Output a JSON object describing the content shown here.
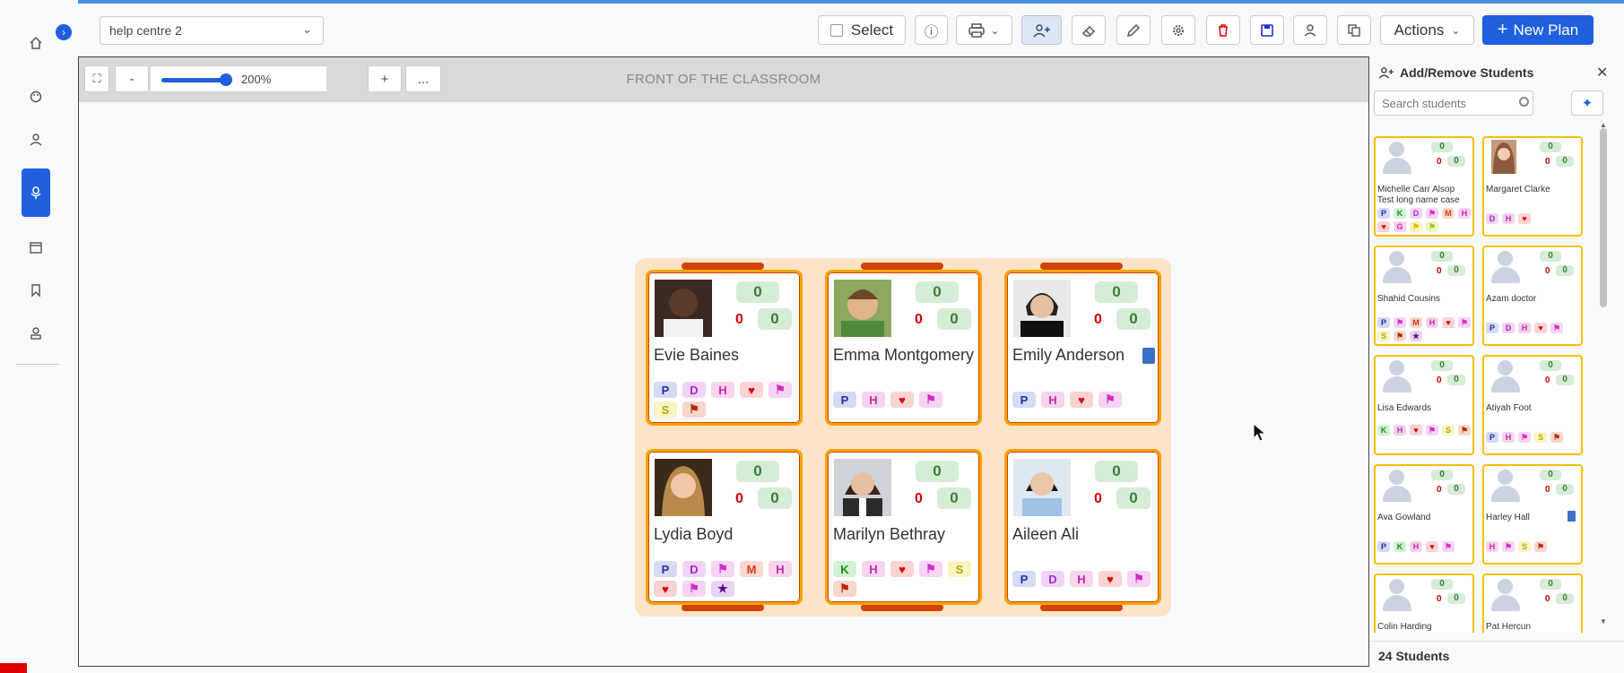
{
  "colors": {
    "accent": "#1f5fe0",
    "desk_border": "#f5a300",
    "desk_bar": "#d14300",
    "group_bg": "#fde3c7"
  },
  "nav": {
    "toggle_icon": "chevron-right-icon",
    "items": [
      {
        "icon": "home-icon"
      },
      {
        "icon": "palette-icon"
      },
      {
        "icon": "user-icon"
      },
      {
        "icon": "classroom-icon",
        "active": true
      },
      {
        "icon": "calendar-icon"
      },
      {
        "icon": "bookmark-icon"
      },
      {
        "icon": "teacher-icon"
      }
    ]
  },
  "toolbar": {
    "plan_name": "help centre 2",
    "select_label": "Select",
    "actions_label": "Actions",
    "new_plan_label": "New Plan"
  },
  "canvas": {
    "front_label": "FRONT OF THE CLASSROOM",
    "zoom_out": "-",
    "zoom_in": "+",
    "more": "...",
    "zoom_value": "200%"
  },
  "students_on_desk": [
    {
      "name": "Evie Baines",
      "score": "0",
      "neg": "0",
      "pos": "0",
      "tags": [
        "P",
        "D",
        "H",
        "heart",
        "flag",
        "S",
        "flag2"
      ]
    },
    {
      "name": "Emma Montgomery",
      "score": "0",
      "neg": "0",
      "pos": "0",
      "tags": [
        "P",
        "H",
        "heart",
        "flag"
      ]
    },
    {
      "name": "Emily Anderson",
      "score": "0",
      "neg": "0",
      "pos": "0",
      "tags": [
        "P",
        "H",
        "heart",
        "flag"
      ],
      "doc": true
    },
    {
      "name": "Lydia Boyd",
      "score": "0",
      "neg": "0",
      "pos": "0",
      "tags": [
        "P",
        "D",
        "flag",
        "M",
        "H",
        "heart",
        "flag",
        "star"
      ]
    },
    {
      "name": "Marilyn Bethray",
      "score": "0",
      "neg": "0",
      "pos": "0",
      "tags": [
        "K",
        "H",
        "heart",
        "flag",
        "S",
        "flag2"
      ]
    },
    {
      "name": "Aileen Ali",
      "score": "0",
      "neg": "0",
      "pos": "0",
      "tags": [
        "P",
        "D",
        "H",
        "heart",
        "flag"
      ]
    }
  ],
  "panel": {
    "title": "Add/Remove Students",
    "search_placeholder": "Search students",
    "footer": "24 Students",
    "students": [
      {
        "name": "Michelle Carr Alsop Test long name case",
        "s": "0",
        "r": "0",
        "g": "0",
        "tags": [
          "P",
          "K",
          "D",
          "flag",
          "M",
          "H",
          "heart",
          "G",
          "Y",
          "gflag"
        ]
      },
      {
        "name": "Margaret Clarke",
        "s": "0",
        "r": "0",
        "g": "0",
        "photo": true,
        "tags": [
          "D",
          "H",
          "heart"
        ]
      },
      {
        "name": "Shahid Cousins",
        "s": "0",
        "r": "0",
        "g": "0",
        "tags": [
          "P",
          "flag",
          "M",
          "H",
          "heart",
          "flag",
          "S",
          "flag2",
          "star"
        ]
      },
      {
        "name": "Azam doctor",
        "s": "0",
        "r": "0",
        "g": "0",
        "tags": [
          "P",
          "D",
          "H",
          "heart",
          "flag"
        ]
      },
      {
        "name": "Lisa Edwards",
        "s": "0",
        "r": "0",
        "g": "0",
        "tags": [
          "K",
          "H",
          "heart",
          "flag",
          "S",
          "flag2"
        ]
      },
      {
        "name": "Atiyah Foot",
        "s": "0",
        "r": "0",
        "g": "0",
        "tags": [
          "P",
          "H",
          "flag",
          "S",
          "flag2"
        ]
      },
      {
        "name": "Ava Gowland",
        "s": "0",
        "r": "0",
        "g": "0",
        "tags": [
          "P",
          "K",
          "H",
          "heart",
          "flag"
        ]
      },
      {
        "name": "Harley Hall",
        "s": "0",
        "r": "0",
        "g": "0",
        "doc": true,
        "tags": [
          "H",
          "flag",
          "S",
          "flag2"
        ]
      },
      {
        "name": "Colin Harding",
        "s": "0",
        "r": "0",
        "g": "0",
        "tags": []
      },
      {
        "name": "Pat Hercun",
        "s": "0",
        "r": "0",
        "g": "0",
        "tags": []
      }
    ]
  }
}
